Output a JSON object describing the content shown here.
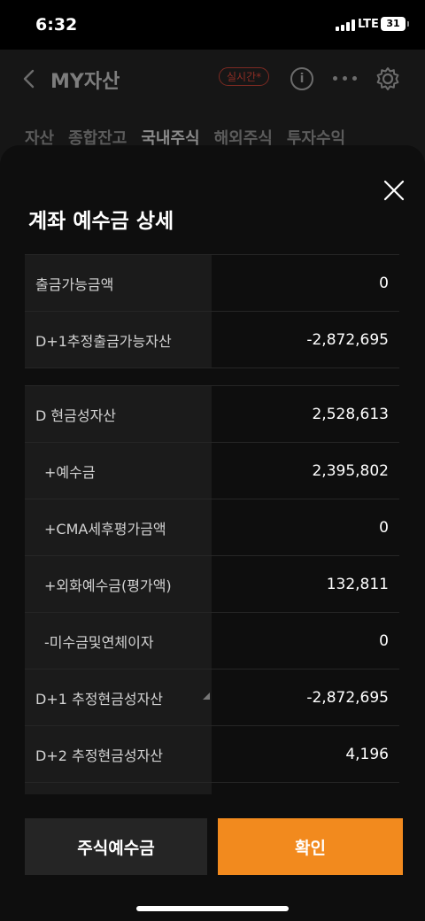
{
  "status_bar": {
    "time": "6:32",
    "network": "LTE",
    "battery": "31"
  },
  "background_screen": {
    "title": "MY자산",
    "realtime_badge": "실시간*",
    "info_icon": "i",
    "tabs": [
      "자산",
      "종합잔고",
      "국내주식",
      "해외주식",
      "투자수익"
    ],
    "active_tab": "국내주식"
  },
  "sheet": {
    "title": "계좌 예수금 상세",
    "rows": [
      {
        "label": "출금가능금액",
        "value": "0"
      },
      {
        "label": "D+1추정출금가능자산",
        "value": "-2,872,695"
      },
      {
        "label": "D 현금성자산",
        "value": "2,528,613"
      },
      {
        "label": "+예수금",
        "value": "2,395,802"
      },
      {
        "label": "+CMA세후평가금액",
        "value": "0"
      },
      {
        "label": "+외화예수금(평가액)",
        "value": "132,811"
      },
      {
        "label": "-미수금및연체이자",
        "value": "0"
      },
      {
        "label": "D+1 추정현금성자산",
        "value": "-2,872,695"
      },
      {
        "label": "D+2 추정현금성자산",
        "value": "4,196"
      }
    ],
    "buttons": {
      "deposit": "주식예수금",
      "confirm": "확인"
    }
  },
  "colors": {
    "accent": "#f28a1e",
    "sheet_bg": "#0e0e0e",
    "label_bg": "#1b1b1b",
    "realtime_badge": "#8e2d24"
  },
  "icons": [
    "back-icon",
    "info-icon",
    "more-icon",
    "gear-icon",
    "close-icon",
    "signal-icon",
    "battery-icon",
    "expand-corner-icon"
  ]
}
